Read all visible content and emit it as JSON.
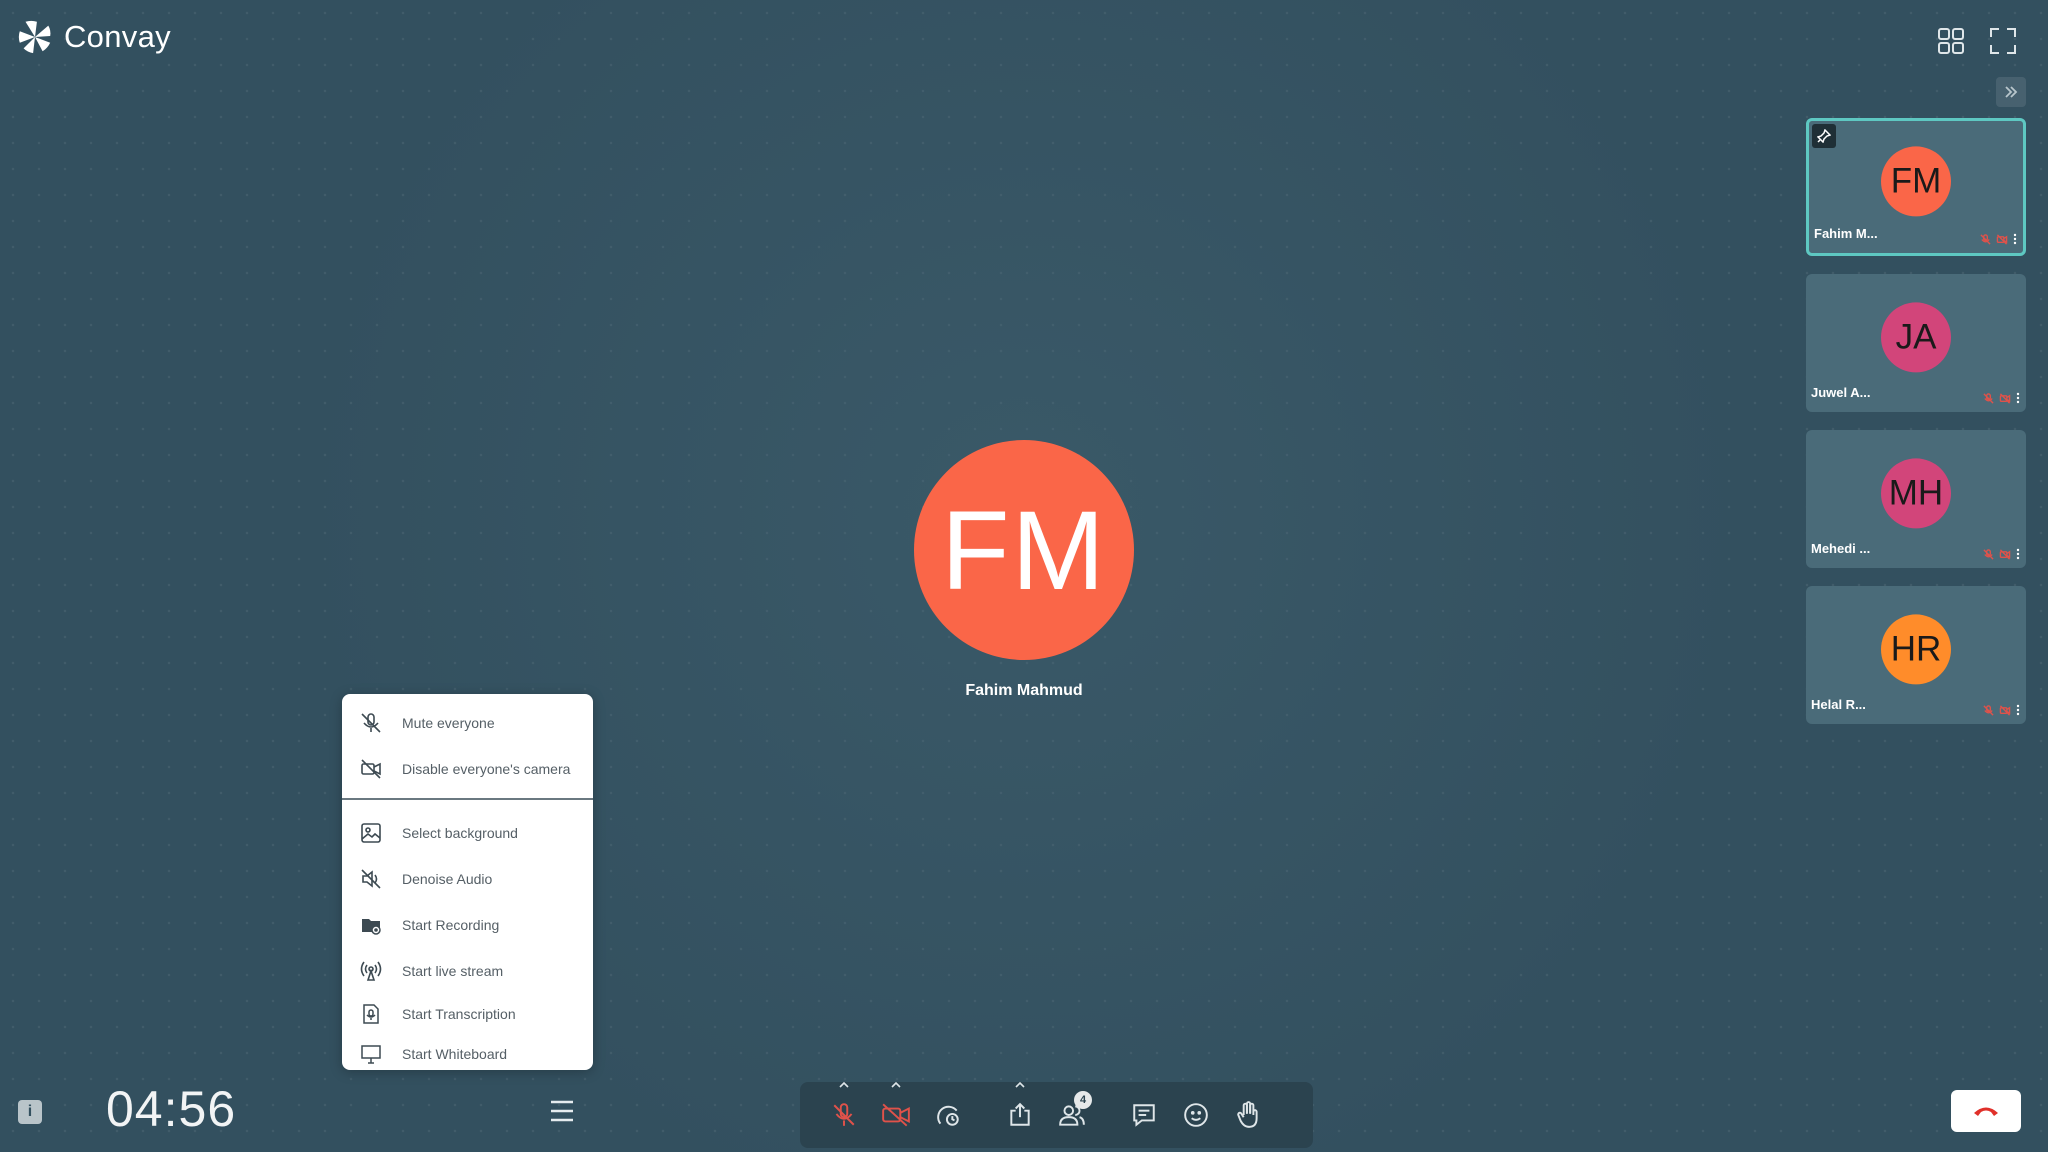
{
  "app": {
    "brand_name": "Convay"
  },
  "main_speaker": {
    "initials": "FM",
    "name": "Fahim Mahmud",
    "color": "#fa6648"
  },
  "participants": [
    {
      "initials": "FM",
      "name": "Fahim M...",
      "color": "#fa6648",
      "pinned": true,
      "active": true
    },
    {
      "initials": "JA",
      "name": "Juwel A...",
      "color": "#d2457a"
    },
    {
      "initials": "MH",
      "name": "Mehedi ...",
      "color": "#d2457a"
    },
    {
      "initials": "HR",
      "name": "Helal R...",
      "color": "#ff8c2a"
    }
  ],
  "menu": {
    "items": [
      {
        "label": "Mute everyone",
        "icon": "mic-off-icon"
      },
      {
        "label": "Disable everyone's camera",
        "icon": "camera-off-icon"
      },
      {
        "label": "Select background",
        "icon": "image-icon"
      },
      {
        "label": "Denoise Audio",
        "icon": "denoise-icon"
      },
      {
        "label": "Start Recording",
        "icon": "recording-icon"
      },
      {
        "label": "Start live stream",
        "icon": "broadcast-icon"
      },
      {
        "label": "Start Transcription",
        "icon": "transcription-icon"
      },
      {
        "label": "Start Whiteboard",
        "icon": "whiteboard-icon"
      }
    ]
  },
  "timer": "04:56",
  "toolbar": {
    "participants_count": "4"
  },
  "colors": {
    "background": "#33505f",
    "accent": "#5ec8c2",
    "muted_red": "#e0524a",
    "end_call_red": "#e0302a"
  }
}
